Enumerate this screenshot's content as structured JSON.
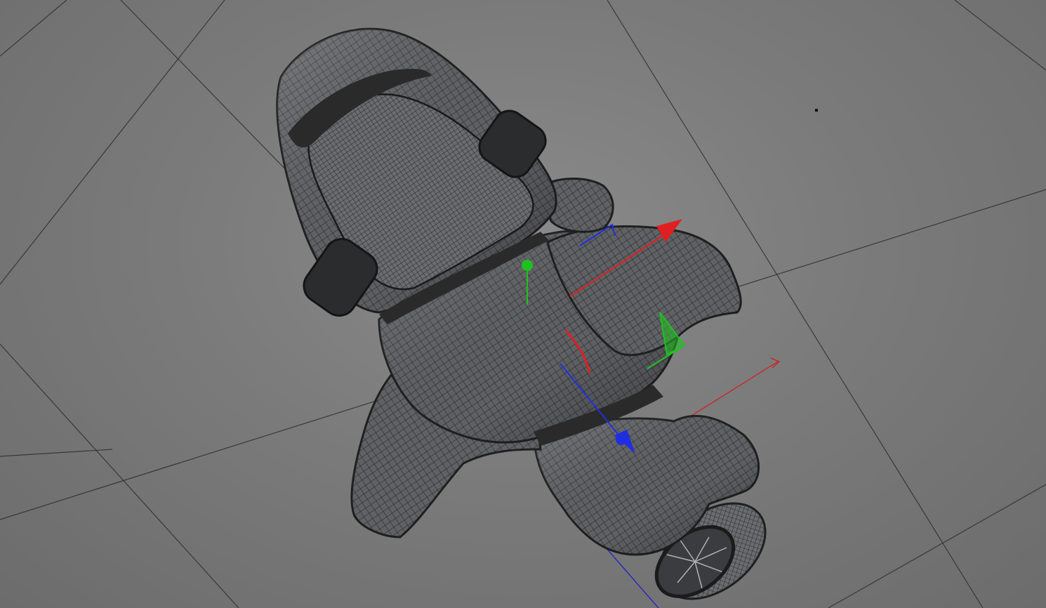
{
  "viewport": {
    "background_color": "#767676",
    "grid_color": "#2e2e2e",
    "model_fill_color": "#5e6064",
    "wire_color": "#222222"
  },
  "gizmo": {
    "x_axis_color": "#e02020",
    "y_axis_color": "#1ec21e",
    "z_axis_color": "#1f2fe0"
  },
  "world_axes": {
    "x_axis_color": "#d02020",
    "y_axis_color": "#18b018",
    "z_axis_color": "#2020c8"
  }
}
